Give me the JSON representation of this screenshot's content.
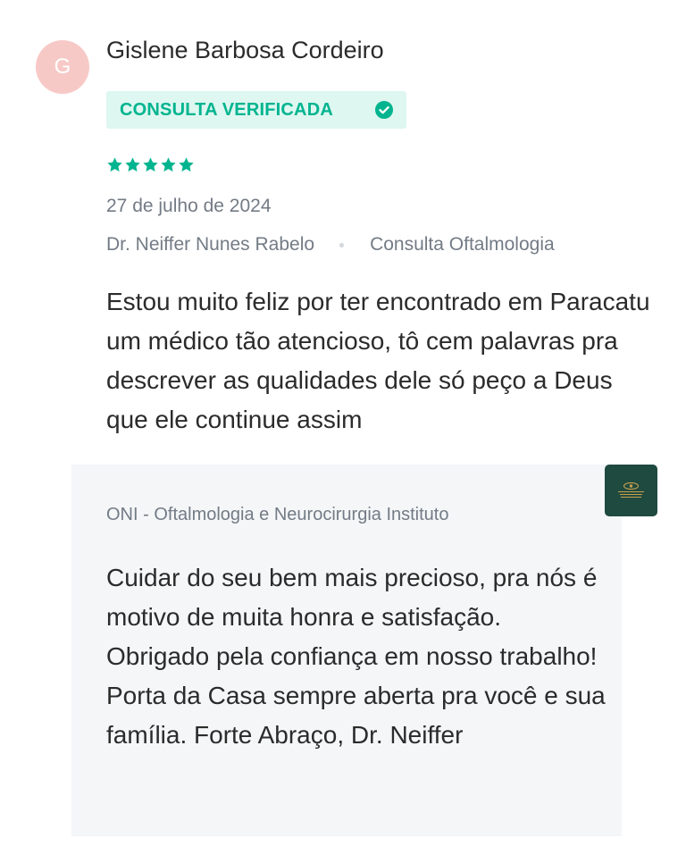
{
  "review": {
    "avatar_initial": "G",
    "author_name": "Gislene Barbosa Cordeiro",
    "badge_label": "CONSULTA VERIFICADA",
    "rating": 5,
    "rating_max": 5,
    "date": "27 de julho de 2024",
    "doctor": "Dr. Neiffer Nunes Rabelo",
    "service": "Consulta Oftalmologia",
    "text": "Estou muito feliz por ter encontrado em Paracatu um médico tão atencioso, tô cem palavras pra descrever as qualidades dele só peço a Deus que ele continue assim"
  },
  "reply": {
    "author": "ONI - Oftalmologia e Neurocirurgia Instituto",
    "logo_text": "INSTITUTO",
    "text": "Cuidar do seu bem mais precioso, pra nós é motivo de muita honra e satisfação. Obrigado pela confiança em nosso trabalho! Porta da Casa sempre aberta pra você e sua família. Forte Abraço, Dr. Neiffer"
  },
  "colors": {
    "accent": "#00b48f",
    "badge_bg": "#def7f0",
    "avatar_bg": "#f7c9c6",
    "muted_text": "#737b85",
    "reply_bg": "#f4f6f8",
    "logo_bg": "#1f4a40"
  },
  "icons": {
    "verified": "check-circle-icon",
    "rating": "star-icon",
    "logo": "clinic-logo"
  }
}
